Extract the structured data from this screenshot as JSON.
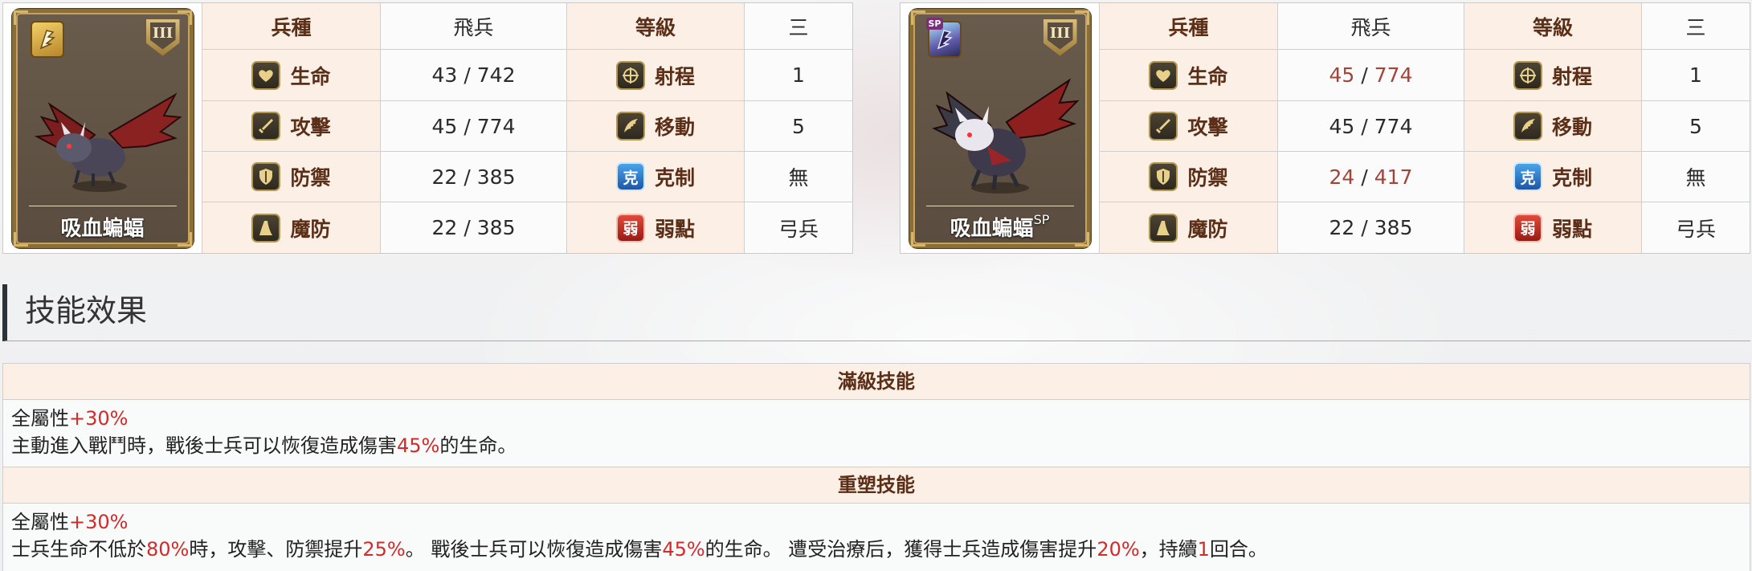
{
  "labels": {
    "troop_type": "兵種",
    "level": "等級",
    "hp": "生命",
    "range": "射程",
    "atk": "攻擊",
    "move": "移動",
    "def": "防禦",
    "counter": "克制",
    "mdef": "魔防",
    "weakness": "弱點"
  },
  "icons": {
    "hp": "heart-icon",
    "range": "crosshair-icon",
    "atk": "sword-icon",
    "move": "wing-icon",
    "def": "shield-icon",
    "counter": "counter-icon",
    "mdef": "cloak-icon",
    "weakness": "weakness-icon",
    "counter_glyph": "克",
    "weakness_glyph": "弱"
  },
  "units": [
    {
      "name": "吸血蝙蝠",
      "name_sup": "",
      "rank": "III",
      "troop_type": "飛兵",
      "level": "三",
      "hp": {
        "base": "43",
        "max": "742",
        "highlight": false
      },
      "atk": {
        "base": "45",
        "max": "774",
        "highlight": false
      },
      "def": {
        "base": "22",
        "max": "385",
        "highlight": false
      },
      "mdef": {
        "base": "22",
        "max": "385",
        "highlight": false
      },
      "range": "1",
      "move": "5",
      "counter": "無",
      "weakness": "弓兵"
    },
    {
      "name": "吸血蝙蝠",
      "name_sup": "SP",
      "rank": "III",
      "troop_type": "飛兵",
      "level": "三",
      "hp": {
        "base": "45",
        "max": "774",
        "highlight": true
      },
      "atk": {
        "base": "45",
        "max": "774",
        "highlight": false
      },
      "def": {
        "base": "24",
        "max": "417",
        "highlight": true
      },
      "mdef": {
        "base": "22",
        "max": "385",
        "highlight": false
      },
      "range": "1",
      "move": "5",
      "counter": "無",
      "weakness": "弓兵"
    }
  ],
  "section_title": "技能效果",
  "skills": [
    {
      "title": "滿級技能",
      "lines": [
        [
          {
            "t": "全屬性",
            "red": false
          },
          {
            "t": "+30%",
            "red": true
          }
        ],
        [
          {
            "t": "主動進入戰鬥時，戰後士兵可以恢復造成傷害",
            "red": false
          },
          {
            "t": "45%",
            "red": true
          },
          {
            "t": "的生命。",
            "red": false
          }
        ]
      ]
    },
    {
      "title": "重塑技能",
      "lines": [
        [
          {
            "t": "全屬性",
            "red": false
          },
          {
            "t": "+30%",
            "red": true
          }
        ],
        [
          {
            "t": "士兵生命不低於",
            "red": false
          },
          {
            "t": "80%",
            "red": true
          },
          {
            "t": "時，攻擊、防禦提升",
            "red": false
          },
          {
            "t": "25%",
            "red": true
          },
          {
            "t": "。 戰後士兵可以恢復造成傷害",
            "red": false
          },
          {
            "t": "45%",
            "red": true
          },
          {
            "t": "的生命。 遭受治療后，獲得士兵造成傷害提升",
            "red": false
          },
          {
            "t": "20%",
            "red": true
          },
          {
            "t": "，持續",
            "red": false
          },
          {
            "t": "1",
            "red": true
          },
          {
            "t": "回合。",
            "red": false
          }
        ]
      ]
    }
  ]
}
